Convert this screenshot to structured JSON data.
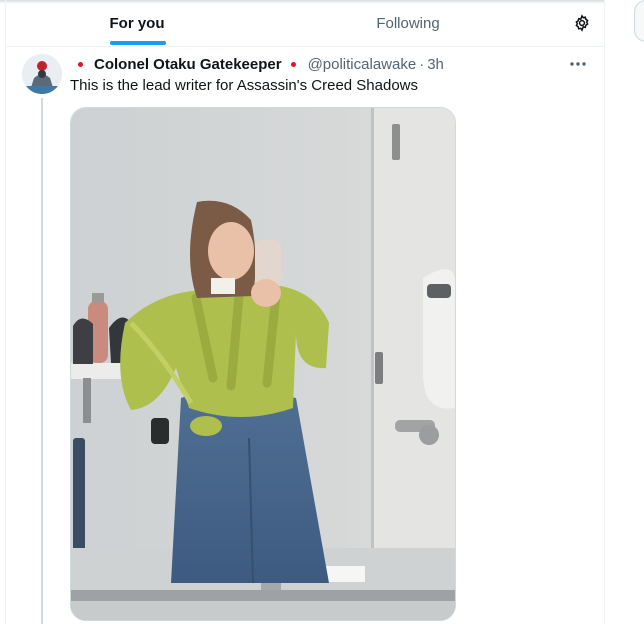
{
  "tabs": [
    {
      "label": "For you",
      "active": true
    },
    {
      "label": "Following",
      "active": false
    }
  ],
  "icons": {
    "settings": "gear-icon",
    "more": "more-horizontal-icon"
  },
  "colors": {
    "accent": "#1d9bf0",
    "flag_red": "#e0142c",
    "secondary_text": "#536471"
  },
  "tweet": {
    "display_name": "Colonel Otaku Gatekeeper",
    "handle": "@politicalawake",
    "separator": "·",
    "time": "3h",
    "text": "This is the lead writer for Assassin's Creed Shadows",
    "media_alt": "mirror-selfie-photo"
  }
}
